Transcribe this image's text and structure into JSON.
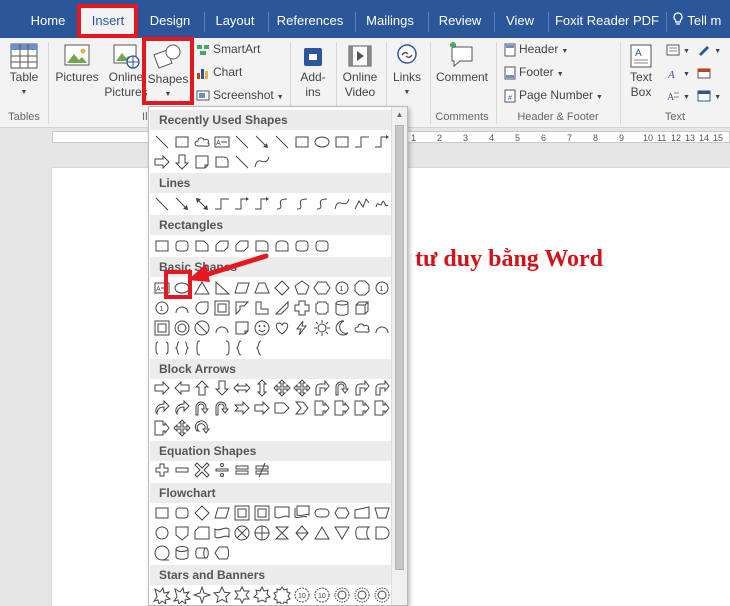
{
  "tabs": [
    {
      "label": "Home",
      "active": false
    },
    {
      "label": "Insert",
      "active": true
    },
    {
      "label": "Design",
      "active": false
    },
    {
      "label": "Layout",
      "active": false
    },
    {
      "label": "References",
      "active": false
    },
    {
      "label": "Mailings",
      "active": false
    },
    {
      "label": "Review",
      "active": false
    },
    {
      "label": "View",
      "active": false
    },
    {
      "label": "Foxit Reader PDF",
      "active": false
    }
  ],
  "tell_me": "Tell m",
  "ribbon": {
    "table": {
      "label": "Table",
      "group": "Tables"
    },
    "pictures": "Pictures",
    "online_pictures": [
      "Online",
      "Pictures"
    ],
    "shapes": "Shapes",
    "illustrations_group": "Ill",
    "smartart": "SmartArt",
    "chart": "Chart",
    "screenshot": "Screenshot",
    "addins": [
      "Add-",
      "ins"
    ],
    "online_video": [
      "Online",
      "Video"
    ],
    "links": "Links",
    "comment": "Comment",
    "comments_group": "Comments",
    "header": "Header",
    "footer": "Footer",
    "page_number": "Page Number",
    "header_footer_group": "Header & Footer",
    "text_box": [
      "Text",
      "Box"
    ],
    "text_group": "Text"
  },
  "ruler_numbers": [
    "1",
    "2",
    "3",
    "4",
    "5",
    "6",
    "7",
    "8",
    "9",
    "10",
    "11",
    "12",
    "13",
    "14",
    "15"
  ],
  "document": {
    "visible_text": "tư duy bằng Word"
  },
  "shapes_panel": {
    "sections": [
      "Recently Used Shapes",
      "Lines",
      "Rectangles",
      "Basic Shapes",
      "Block Arrows",
      "Equation Shapes",
      "Flowchart",
      "Stars and Banners"
    ],
    "highlighted_shape": "oval"
  },
  "colors": {
    "tab_bar": "#2b579a",
    "highlight": "#e5171f",
    "doc_text": "#d2131a"
  }
}
